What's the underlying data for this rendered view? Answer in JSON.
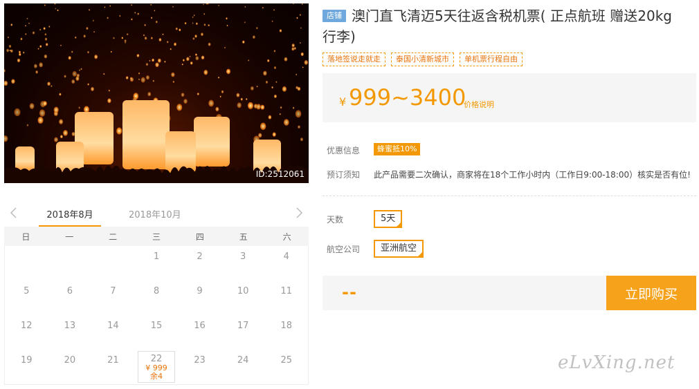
{
  "product": {
    "image_id": "ID:2512061",
    "shop_badge": "店铺",
    "title": "澳门直飞清迈5天往返含税机票( 正点航班 赠送20kg行李)",
    "tags": [
      "落地签说走就走",
      "泰国小清新城市",
      "单机票行程自由"
    ],
    "price_symbol": "¥",
    "price_range": "999~3400",
    "price_note": "价格说明"
  },
  "info": {
    "promo_label": "优惠信息",
    "promo_badge": "蜂蜜抵10%",
    "notice_label": "预订须知",
    "notice_text": "此产品需要二次确认，商家将在18个工作小时内（工作日9:00-18:00）核实是否有位!"
  },
  "options": {
    "days_label": "天数",
    "days_value": "5天",
    "airline_label": "航空公司",
    "airline_value": "亚洲航空"
  },
  "purchase": {
    "total": "--",
    "buy_label": "立即购买"
  },
  "calendar": {
    "months": [
      "2018年8月",
      "2018年10月"
    ],
    "weekdays": [
      "日",
      "一",
      "二",
      "三",
      "四",
      "五",
      "六"
    ],
    "leading_blanks": 3,
    "days": [
      "1",
      "2",
      "3",
      "4",
      "5",
      "6",
      "7",
      "8",
      "9",
      "10",
      "11",
      "12",
      "13",
      "14",
      "15",
      "16",
      "17",
      "18",
      "19",
      "20",
      "21",
      "22",
      "23",
      "24",
      "25"
    ],
    "selected_day": {
      "day": "22",
      "price": "¥ 999",
      "stock": "余4"
    }
  },
  "watermark": "eLvXing.net",
  "colors": {
    "accent": "#f39800",
    "badge_blue": "#6fa8dc"
  }
}
